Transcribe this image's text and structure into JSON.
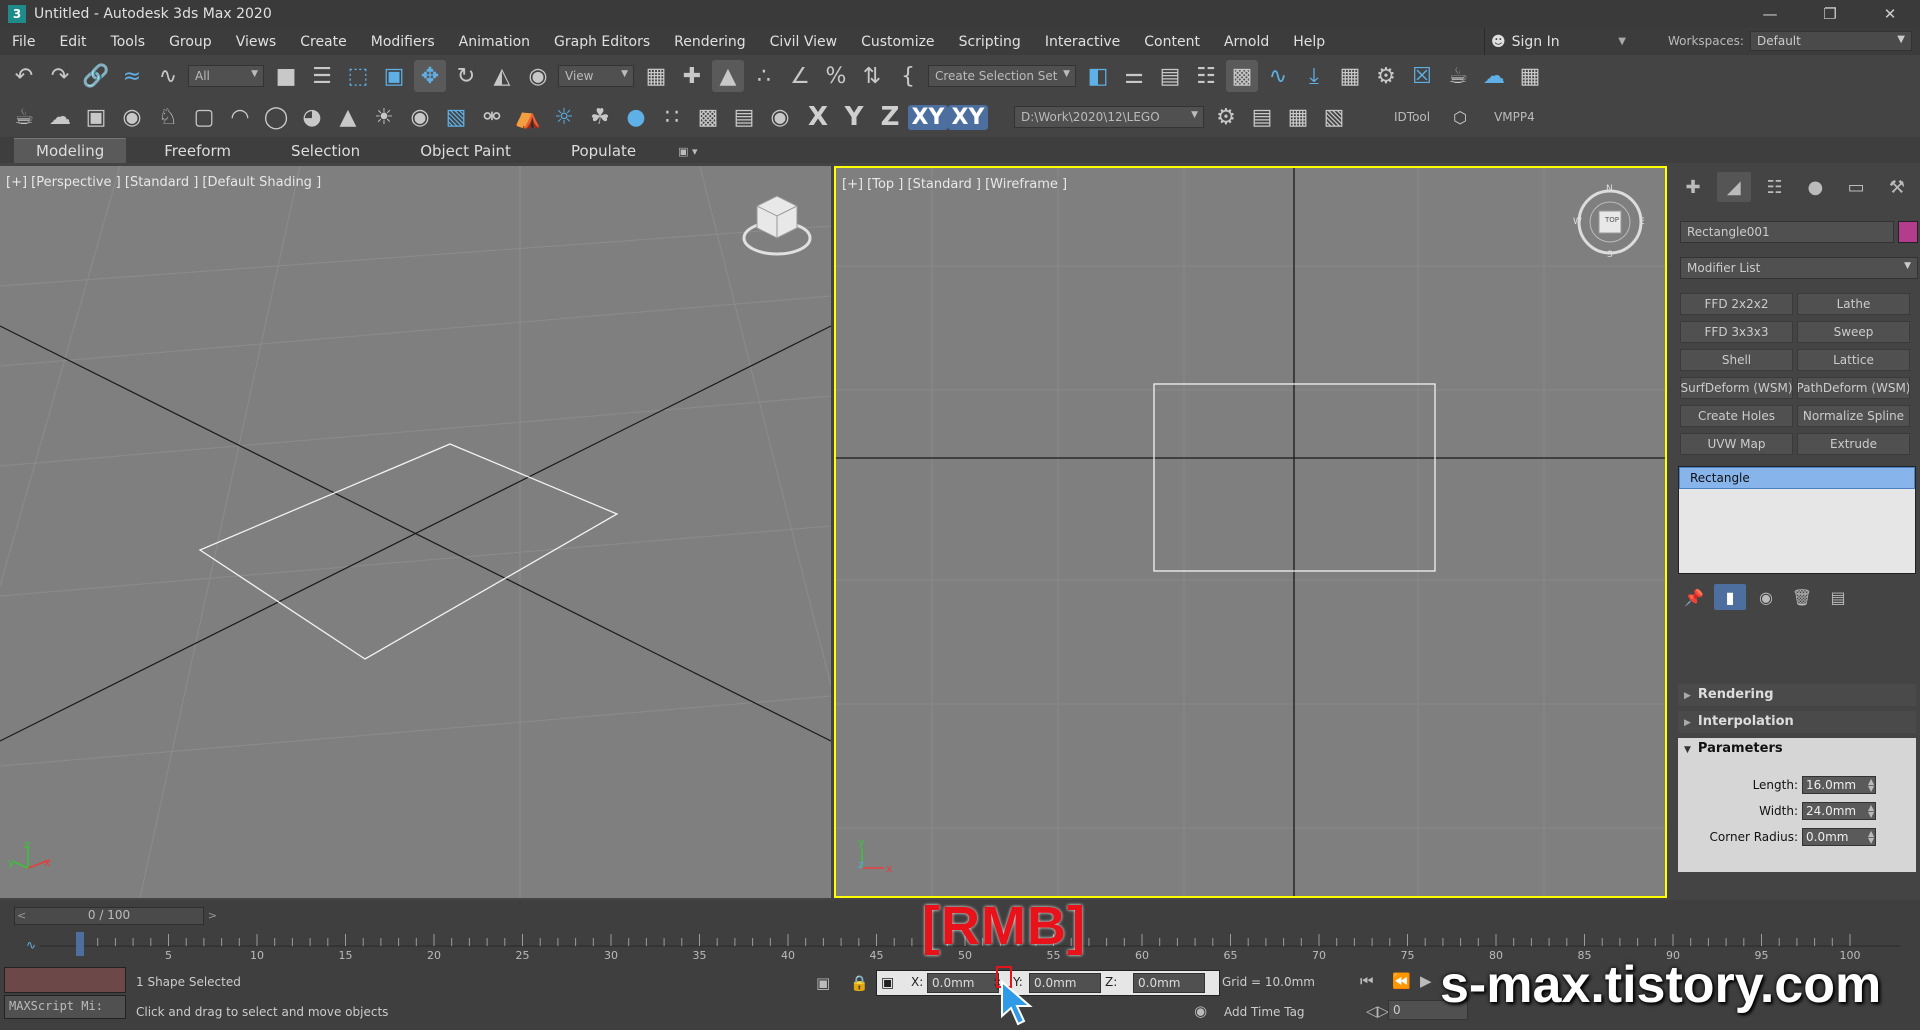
{
  "window": {
    "title": "Untitled - Autodesk 3ds Max 2020",
    "app_icon": "3"
  },
  "menu": [
    "File",
    "Edit",
    "Tools",
    "Group",
    "Views",
    "Create",
    "Modifiers",
    "Animation",
    "Graph Editors",
    "Rendering",
    "Civil View",
    "Customize",
    "Scripting",
    "Interactive",
    "Content",
    "Arnold",
    "Help"
  ],
  "signin": "Sign In",
  "workspaces": {
    "label": "Workspaces:",
    "value": "Default"
  },
  "toolbar": {
    "filter": "All",
    "ref_coord": "View",
    "selection_set": "Create Selection Set",
    "axes": [
      "X",
      "Y",
      "Z",
      "XY",
      "XY"
    ],
    "project_path": "D:\\Work\\2020\\12\\LEGO",
    "idtool": "IDTool",
    "vmpp4": "VMPP4"
  },
  "ribbon": [
    "Modeling",
    "Freeform",
    "Selection",
    "Object Paint",
    "Populate"
  ],
  "viewports": {
    "perspective_label": "[+] [Perspective ] [Standard ] [Default Shading ]",
    "top_label": "[+] [Top ] [Standard ] [Wireframe ]",
    "compass": {
      "n": "N",
      "s": "S",
      "e": "E",
      "w": "W",
      "cube": "TOP"
    },
    "axis_x": "x",
    "axis_y": "y",
    "axis_z": "z"
  },
  "command_panel": {
    "object_name": "Rectangle001",
    "object_color": "#b43c8c",
    "modifier_list": "Modifier List",
    "modifier_buttons": [
      "FFD 2x2x2",
      "Lathe",
      "FFD 3x3x3",
      "Sweep",
      "Shell",
      "Lattice",
      "SurfDeform (WSM)",
      "PathDeform (WSM)",
      "Create Holes",
      "Normalize Spline",
      "UVW Map",
      "Extrude"
    ],
    "stack_item": "Rectangle",
    "rollouts": {
      "rendering": "Rendering",
      "interpolation": "Interpolation",
      "parameters": "Parameters"
    },
    "params": [
      {
        "label": "Length:",
        "value": "16.0mm"
      },
      {
        "label": "Width:",
        "value": "24.0mm"
      },
      {
        "label": "Corner Radius:",
        "value": "0.0mm"
      }
    ]
  },
  "timeline": {
    "slider": "0 / 100",
    "ticks": [
      "5",
      "10",
      "15",
      "20",
      "25",
      "30",
      "35",
      "40",
      "45",
      "50",
      "55",
      "60",
      "65",
      "70",
      "75",
      "80",
      "85",
      "90",
      "95",
      "100"
    ]
  },
  "status": {
    "maxscript": "MAXScript Mi:",
    "selected": "1 Shape Selected",
    "prompt": "Click and drag to select and move objects",
    "x_label": "X:",
    "x": "0.0mm",
    "y_label": "Y:",
    "y": "0.0mm",
    "z_label": "Z:",
    "z": "0.0mm",
    "grid": "Grid = 10.0mm",
    "add_time_tag": "Add Time Tag",
    "frame": "0"
  },
  "overlay": {
    "rmb": "[RMB]",
    "watermark": "s-max.tistory.com"
  }
}
